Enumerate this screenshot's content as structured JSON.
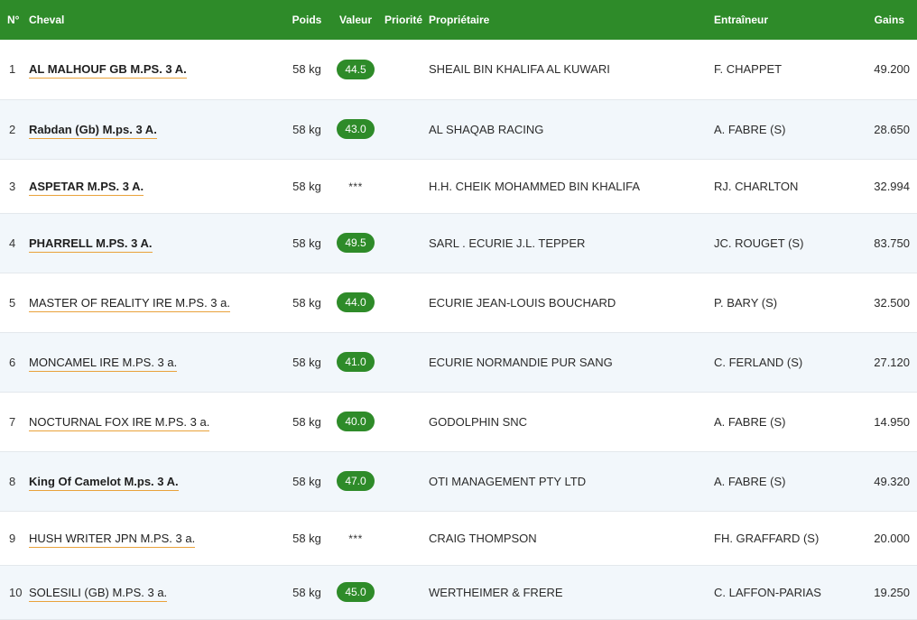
{
  "headers": {
    "num": "N°",
    "horse": "Cheval",
    "weight": "Poids",
    "value": "Valeur",
    "priority": "Priorité",
    "owner": "Propriétaire",
    "trainer": "Entraîneur",
    "earnings": "Gains"
  },
  "colors": {
    "header_bg": "#2e8b29",
    "value_pill": "#2e8b29",
    "link_underline": "#e9a23b",
    "row_alt": "#f2f7fb"
  },
  "rows": [
    {
      "num": "1",
      "horse": "AL MALHOUF GB M.PS. 3 A.",
      "bold": true,
      "weight": "58 kg",
      "value": "44.5",
      "priority": "",
      "owner": "SHEAIL BIN KHALIFA AL KUWARI",
      "trainer": "F. CHAPPET",
      "earnings": "49.200"
    },
    {
      "num": "2",
      "horse": "Rabdan (Gb) M.ps. 3 A.",
      "bold": true,
      "weight": "58 kg",
      "value": "43.0",
      "priority": "",
      "owner": "AL SHAQAB RACING",
      "trainer": "A. FABRE (S)",
      "earnings": "28.650"
    },
    {
      "num": "3",
      "horse": "ASPETAR M.PS. 3 A.",
      "bold": true,
      "weight": "58 kg",
      "value": "***",
      "priority": "",
      "owner": "H.H. CHEIK MOHAMMED BIN KHALIFA",
      "trainer": "RJ. CHARLTON",
      "earnings": "32.994"
    },
    {
      "num": "4",
      "horse": "PHARRELL M.PS. 3 A.",
      "bold": true,
      "weight": "58 kg",
      "value": "49.5",
      "priority": "",
      "owner": "SARL . ECURIE J.L. TEPPER",
      "trainer": "JC. ROUGET (S)",
      "earnings": "83.750"
    },
    {
      "num": "5",
      "horse": "MASTER OF REALITY IRE M.PS. 3 a.",
      "bold": false,
      "weight": "58 kg",
      "value": "44.0",
      "priority": "",
      "owner": "ECURIE JEAN-LOUIS BOUCHARD",
      "trainer": "P. BARY (S)",
      "earnings": "32.500"
    },
    {
      "num": "6",
      "horse": "MONCAMEL IRE M.PS. 3 a.",
      "bold": false,
      "weight": "58 kg",
      "value": "41.0",
      "priority": "",
      "owner": "ECURIE NORMANDIE PUR SANG",
      "trainer": "C. FERLAND (S)",
      "earnings": "27.120"
    },
    {
      "num": "7",
      "horse": "NOCTURNAL FOX IRE M.PS. 3 a.",
      "bold": false,
      "weight": "58 kg",
      "value": "40.0",
      "priority": "",
      "owner": "GODOLPHIN SNC",
      "trainer": "A. FABRE (S)",
      "earnings": "14.950"
    },
    {
      "num": "8",
      "horse": "King Of Camelot M.ps. 3 A.",
      "bold": true,
      "weight": "58 kg",
      "value": "47.0",
      "priority": "",
      "owner": "OTI MANAGEMENT PTY LTD",
      "trainer": "A. FABRE (S)",
      "earnings": "49.320"
    },
    {
      "num": "9",
      "horse": "HUSH WRITER JPN M.PS. 3 a.",
      "bold": false,
      "weight": "58 kg",
      "value": "***",
      "priority": "",
      "owner": "CRAIG THOMPSON",
      "trainer": "FH. GRAFFARD (S)",
      "earnings": "20.000"
    },
    {
      "num": "10",
      "horse": "SOLESILI (GB) M.PS. 3 a.",
      "bold": false,
      "weight": "58 kg",
      "value": "45.0",
      "priority": "",
      "owner": "WERTHEIMER & FRERE",
      "trainer": "C. LAFFON-PARIAS",
      "earnings": "19.250"
    }
  ]
}
